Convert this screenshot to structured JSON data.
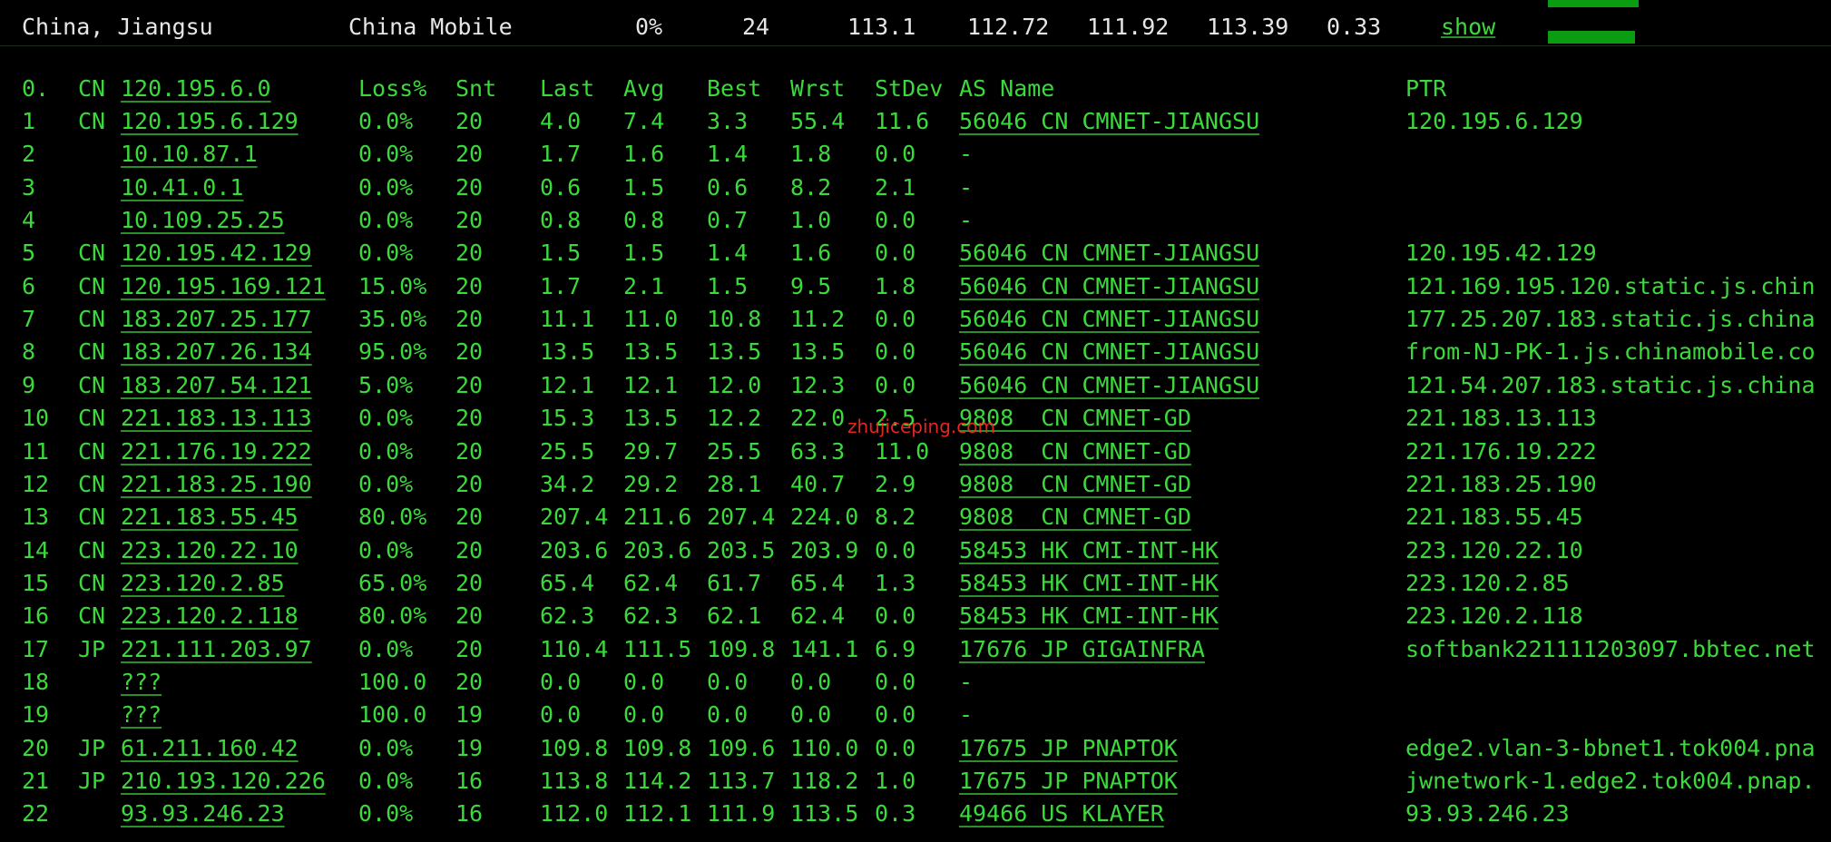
{
  "top_row": {
    "location": "China, Jiangsu",
    "isp": "China Mobile",
    "loss": "0%",
    "count": "24",
    "v1": "113.1",
    "v2": "112.72",
    "v3": "111.92",
    "v4": "113.39",
    "v5": "0.33",
    "show_link": "show"
  },
  "header": {
    "hop": "0.",
    "cc": "CN",
    "ip": "120.195.6.0",
    "loss": "Loss%",
    "snt": "Snt",
    "last": "Last",
    "avg": "Avg",
    "best": "Best",
    "wrst": "Wrst",
    "stdev": "StDev",
    "asname": "AS Name",
    "ptr": "PTR"
  },
  "hops": [
    {
      "hop": "1",
      "cc": "CN",
      "ip": "120.195.6.129",
      "loss": "0.0%",
      "snt": "20",
      "last": "4.0",
      "avg": "7.4",
      "best": "3.3",
      "wrst": "55.4",
      "stdev": "11.6",
      "asname": "56046 CN CMNET-JIANGSU",
      "ptr": "120.195.6.129"
    },
    {
      "hop": "2",
      "cc": "",
      "ip": "10.10.87.1",
      "loss": "0.0%",
      "snt": "20",
      "last": "1.7",
      "avg": "1.6",
      "best": "1.4",
      "wrst": "1.8",
      "stdev": "0.0",
      "asname": "-",
      "ptr": ""
    },
    {
      "hop": "3",
      "cc": "",
      "ip": "10.41.0.1",
      "loss": "0.0%",
      "snt": "20",
      "last": "0.6",
      "avg": "1.5",
      "best": "0.6",
      "wrst": "8.2",
      "stdev": "2.1",
      "asname": "-",
      "ptr": ""
    },
    {
      "hop": "4",
      "cc": "",
      "ip": "10.109.25.25",
      "loss": "0.0%",
      "snt": "20",
      "last": "0.8",
      "avg": "0.8",
      "best": "0.7",
      "wrst": "1.0",
      "stdev": "0.0",
      "asname": "-",
      "ptr": ""
    },
    {
      "hop": "5",
      "cc": "CN",
      "ip": "120.195.42.129",
      "loss": "0.0%",
      "snt": "20",
      "last": "1.5",
      "avg": "1.5",
      "best": "1.4",
      "wrst": "1.6",
      "stdev": "0.0",
      "asname": "56046 CN CMNET-JIANGSU",
      "ptr": "120.195.42.129"
    },
    {
      "hop": "6",
      "cc": "CN",
      "ip": "120.195.169.121",
      "loss": "15.0%",
      "snt": "20",
      "last": "1.7",
      "avg": "2.1",
      "best": "1.5",
      "wrst": "9.5",
      "stdev": "1.8",
      "asname": "56046 CN CMNET-JIANGSU",
      "ptr": "121.169.195.120.static.js.chin"
    },
    {
      "hop": "7",
      "cc": "CN",
      "ip": "183.207.25.177",
      "loss": "35.0%",
      "snt": "20",
      "last": "11.1",
      "avg": "11.0",
      "best": "10.8",
      "wrst": "11.2",
      "stdev": "0.0",
      "asname": "56046 CN CMNET-JIANGSU",
      "ptr": "177.25.207.183.static.js.china"
    },
    {
      "hop": "8",
      "cc": "CN",
      "ip": "183.207.26.134",
      "loss": "95.0%",
      "snt": "20",
      "last": "13.5",
      "avg": "13.5",
      "best": "13.5",
      "wrst": "13.5",
      "stdev": "0.0",
      "asname": "56046 CN CMNET-JIANGSU",
      "ptr": "from-NJ-PK-1.js.chinamobile.co"
    },
    {
      "hop": "9",
      "cc": "CN",
      "ip": "183.207.54.121",
      "loss": "5.0%",
      "snt": "20",
      "last": "12.1",
      "avg": "12.1",
      "best": "12.0",
      "wrst": "12.3",
      "stdev": "0.0",
      "asname": "56046 CN CMNET-JIANGSU",
      "ptr": "121.54.207.183.static.js.china"
    },
    {
      "hop": "10",
      "cc": "CN",
      "ip": "221.183.13.113",
      "loss": "0.0%",
      "snt": "20",
      "last": "15.3",
      "avg": "13.5",
      "best": "12.2",
      "wrst": "22.0",
      "stdev": "2.5",
      "asname": "9808  CN CMNET-GD",
      "ptr": "221.183.13.113"
    },
    {
      "hop": "11",
      "cc": "CN",
      "ip": "221.176.19.222",
      "loss": "0.0%",
      "snt": "20",
      "last": "25.5",
      "avg": "29.7",
      "best": "25.5",
      "wrst": "63.3",
      "stdev": "11.0",
      "asname": "9808  CN CMNET-GD",
      "ptr": "221.176.19.222"
    },
    {
      "hop": "12",
      "cc": "CN",
      "ip": "221.183.25.190",
      "loss": "0.0%",
      "snt": "20",
      "last": "34.2",
      "avg": "29.2",
      "best": "28.1",
      "wrst": "40.7",
      "stdev": "2.9",
      "asname": "9808  CN CMNET-GD",
      "ptr": "221.183.25.190"
    },
    {
      "hop": "13",
      "cc": "CN",
      "ip": "221.183.55.45",
      "loss": "80.0%",
      "snt": "20",
      "last": "207.4",
      "avg": "211.6",
      "best": "207.4",
      "wrst": "224.0",
      "stdev": "8.2",
      "asname": "9808  CN CMNET-GD",
      "ptr": "221.183.55.45"
    },
    {
      "hop": "14",
      "cc": "CN",
      "ip": "223.120.22.10",
      "loss": "0.0%",
      "snt": "20",
      "last": "203.6",
      "avg": "203.6",
      "best": "203.5",
      "wrst": "203.9",
      "stdev": "0.0",
      "asname": "58453 HK CMI-INT-HK",
      "ptr": "223.120.22.10"
    },
    {
      "hop": "15",
      "cc": "CN",
      "ip": "223.120.2.85",
      "loss": "65.0%",
      "snt": "20",
      "last": "65.4",
      "avg": "62.4",
      "best": "61.7",
      "wrst": "65.4",
      "stdev": "1.3",
      "asname": "58453 HK CMI-INT-HK",
      "ptr": "223.120.2.85"
    },
    {
      "hop": "16",
      "cc": "CN",
      "ip": "223.120.2.118",
      "loss": "80.0%",
      "snt": "20",
      "last": "62.3",
      "avg": "62.3",
      "best": "62.1",
      "wrst": "62.4",
      "stdev": "0.0",
      "asname": "58453 HK CMI-INT-HK",
      "ptr": "223.120.2.118"
    },
    {
      "hop": "17",
      "cc": "JP",
      "ip": "221.111.203.97",
      "loss": "0.0%",
      "snt": "20",
      "last": "110.4",
      "avg": "111.5",
      "best": "109.8",
      "wrst": "141.1",
      "stdev": "6.9",
      "asname": "17676 JP GIGAINFRA",
      "ptr": "softbank221111203097.bbtec.net"
    },
    {
      "hop": "18",
      "cc": "",
      "ip": "???",
      "loss": "100.0",
      "snt": "20",
      "last": "0.0",
      "avg": "0.0",
      "best": "0.0",
      "wrst": "0.0",
      "stdev": "0.0",
      "asname": "-",
      "ptr": ""
    },
    {
      "hop": "19",
      "cc": "",
      "ip": "???",
      "loss": "100.0",
      "snt": "19",
      "last": "0.0",
      "avg": "0.0",
      "best": "0.0",
      "wrst": "0.0",
      "stdev": "0.0",
      "asname": "-",
      "ptr": ""
    },
    {
      "hop": "20",
      "cc": "JP",
      "ip": "61.211.160.42",
      "loss": "0.0%",
      "snt": "19",
      "last": "109.8",
      "avg": "109.8",
      "best": "109.6",
      "wrst": "110.0",
      "stdev": "0.0",
      "asname": "17675 JP PNAPTOK",
      "ptr": "edge2.vlan-3-bbnet1.tok004.pna"
    },
    {
      "hop": "21",
      "cc": "JP",
      "ip": "210.193.120.226",
      "loss": "0.0%",
      "snt": "16",
      "last": "113.8",
      "avg": "114.2",
      "best": "113.7",
      "wrst": "118.2",
      "stdev": "1.0",
      "asname": "17675 JP PNAPTOK",
      "ptr": "jwnetwork-1.edge2.tok004.pnap."
    },
    {
      "hop": "22",
      "cc": "",
      "ip": "93.93.246.23",
      "loss": "0.0%",
      "snt": "16",
      "last": "112.0",
      "avg": "112.1",
      "best": "111.9",
      "wrst": "113.5",
      "stdev": "0.3",
      "asname": "49466 US KLAYER",
      "ptr": "93.93.246.23"
    }
  ],
  "watermark": "zhujiceping.com",
  "colors": {
    "background": "#000000",
    "text": "#3bd93b",
    "bar": "#0a9d12",
    "watermark": "#ff2a2a"
  }
}
